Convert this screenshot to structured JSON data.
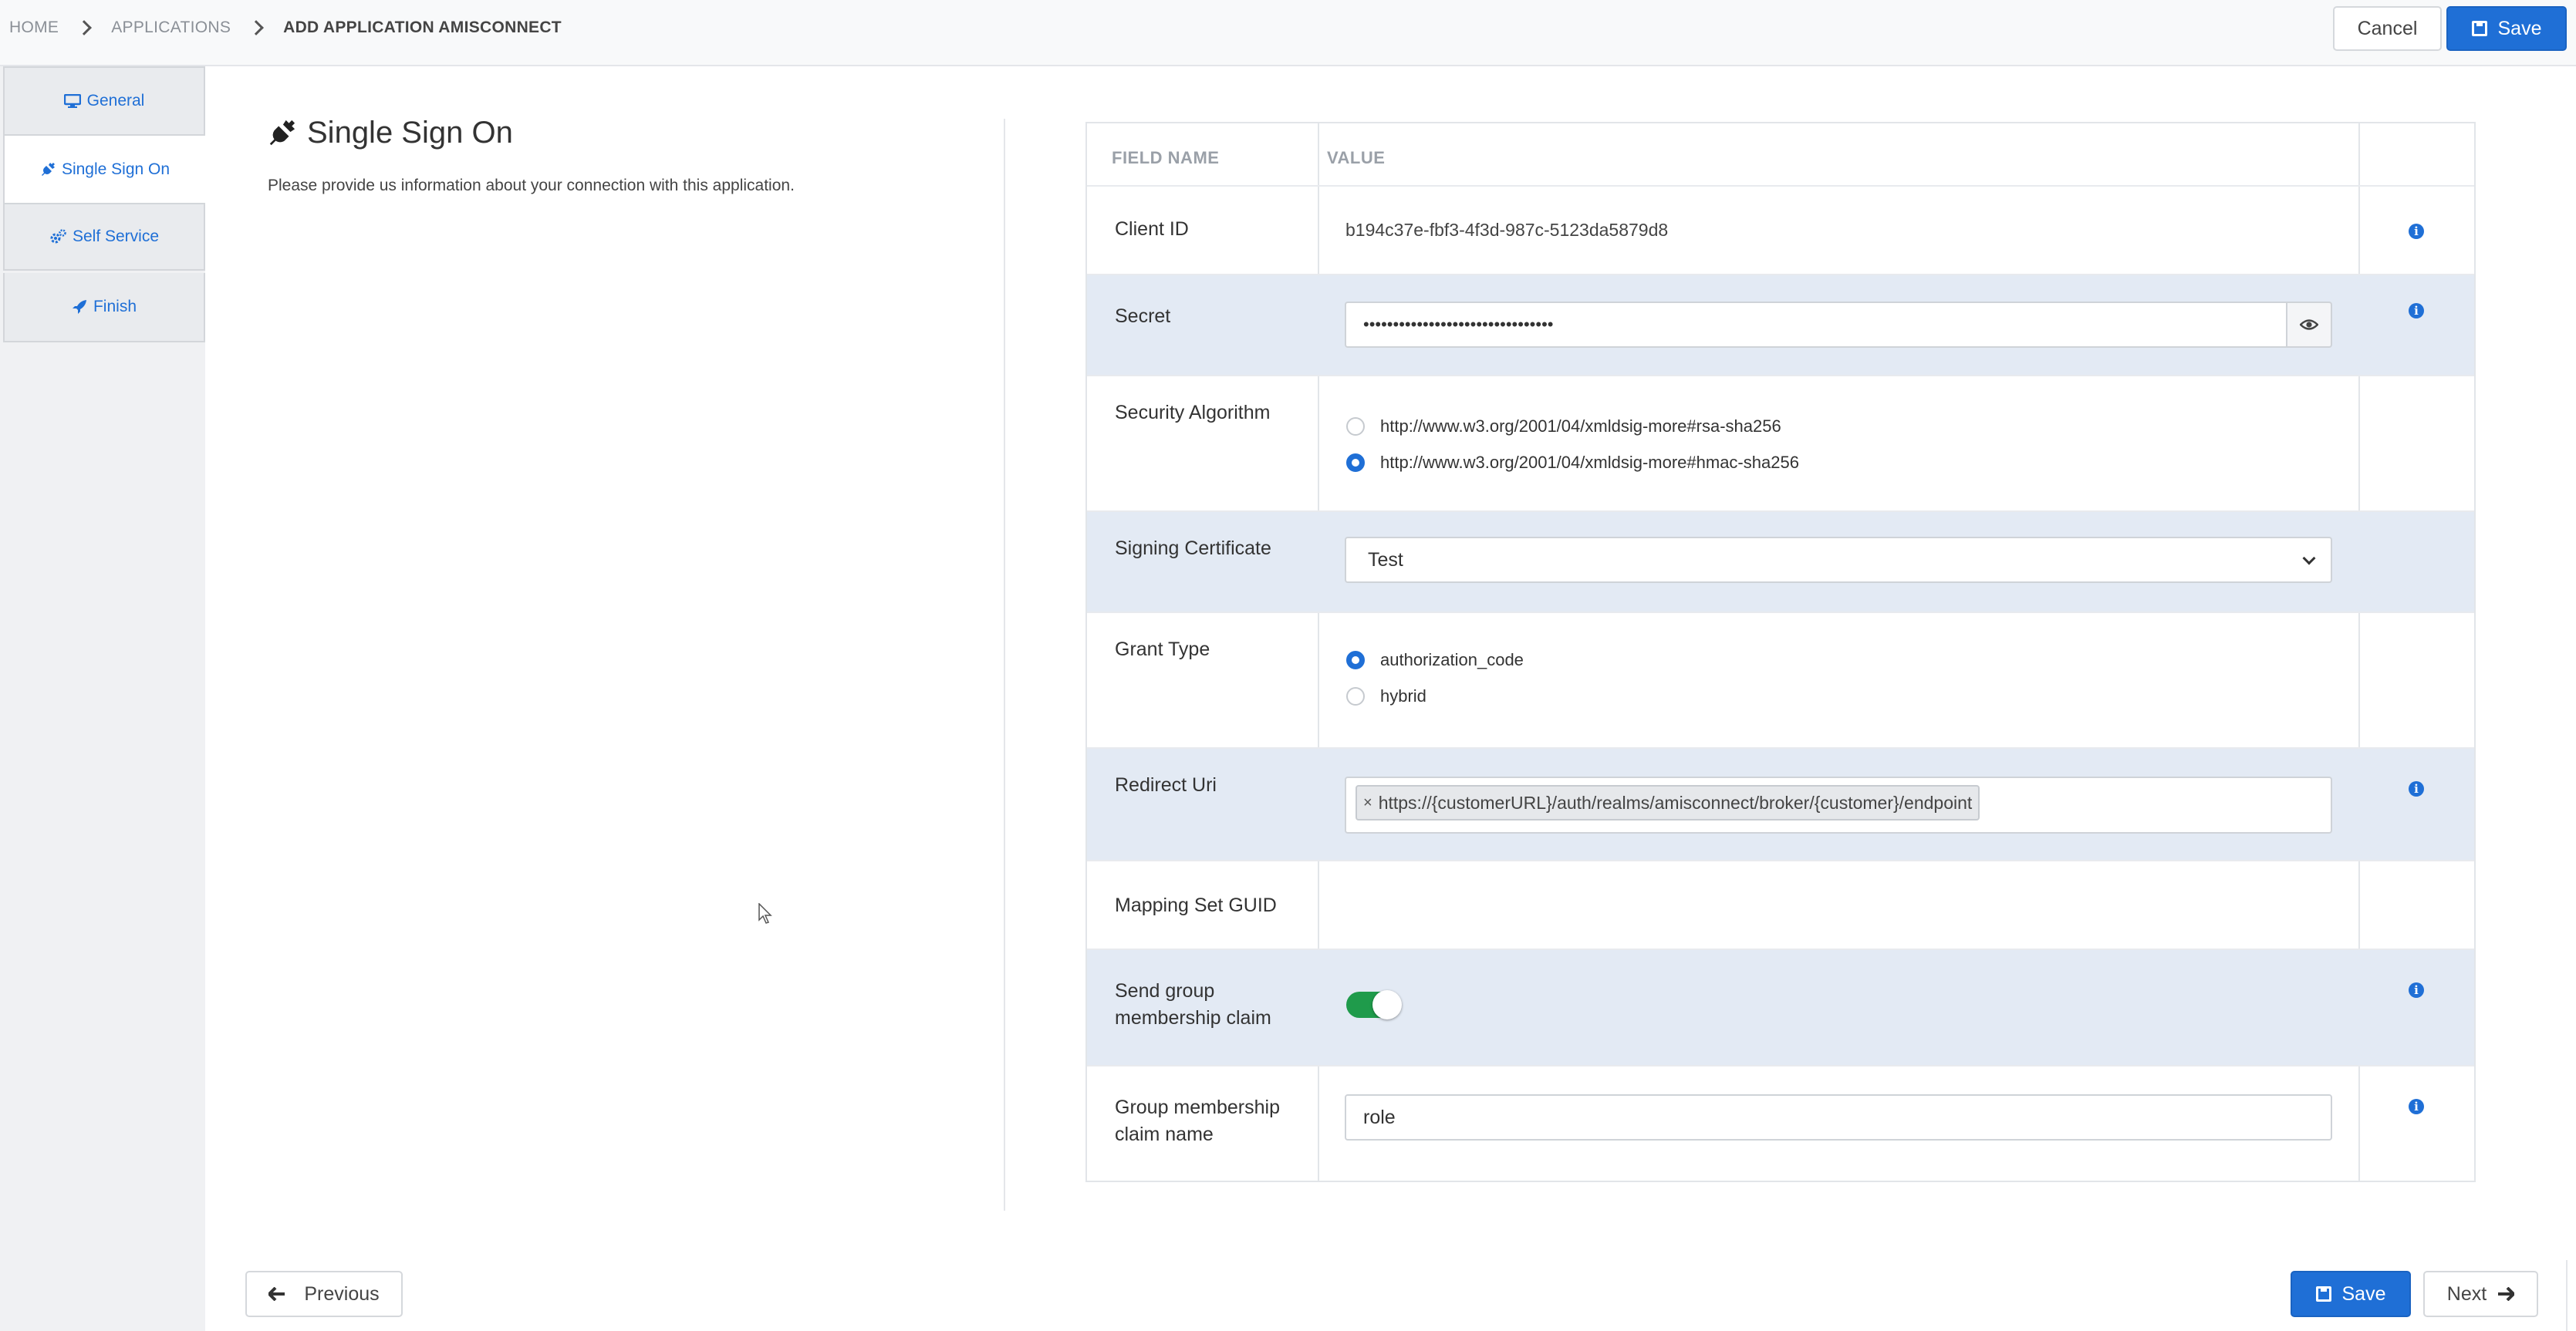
{
  "breadcrumb": {
    "home": "HOME",
    "applications": "APPLICATIONS",
    "current": "ADD APPLICATION AMISCONNECT"
  },
  "toolbar": {
    "cancel_label": "Cancel",
    "save_label": "Save"
  },
  "tabs": [
    {
      "label": "General",
      "icon": "monitor-icon"
    },
    {
      "label": "Single Sign On",
      "icon": "plug-icon",
      "active": true
    },
    {
      "label": "Self Service",
      "icon": "cogs-icon"
    },
    {
      "label": "Finish",
      "icon": "rocket-icon"
    }
  ],
  "section": {
    "title": "Single Sign On",
    "description": "Please provide us information about your connection with this application."
  },
  "table": {
    "headers": {
      "field_name": "FIELD NAME",
      "value": "VALUE"
    },
    "client_id": {
      "label": "Client ID",
      "value": "b194c37e-fbf3-4f3d-987c-5123da5879d8"
    },
    "secret": {
      "label": "Secret",
      "value": "••••••••••••••••••••••••••••••••"
    },
    "security_algorithm": {
      "label": "Security Algorithm",
      "options": [
        {
          "label": "http://www.w3.org/2001/04/xmldsig-more#rsa-sha256",
          "selected": false
        },
        {
          "label": "http://www.w3.org/2001/04/xmldsig-more#hmac-sha256",
          "selected": true
        }
      ]
    },
    "signing_certificate": {
      "label": "Signing Certificate",
      "selected": "Test"
    },
    "grant_type": {
      "label": "Grant Type",
      "options": [
        {
          "label": "authorization_code",
          "selected": true
        },
        {
          "label": "hybrid",
          "selected": false
        }
      ]
    },
    "redirect_uri": {
      "label": "Redirect Uri",
      "tag_remove": "×",
      "tags": [
        "https://{customerURL}/auth/realms/amisconnect/broker/{customer}/endpoint"
      ]
    },
    "mapping_set_guid": {
      "label": "Mapping Set GUID",
      "value": ""
    },
    "send_group_claim": {
      "label": "Send group membership claim",
      "enabled": true
    },
    "group_claim_name": {
      "label": "Group membership claim name",
      "value": "role"
    },
    "info_icon": "i"
  },
  "footer": {
    "previous_label": "Previous",
    "save_label": "Save",
    "next_label": "Next"
  },
  "colors": {
    "primary": "#1f6fd6",
    "row_alt": "#e3eaf4",
    "toggle_on": "#1f9b4b"
  }
}
